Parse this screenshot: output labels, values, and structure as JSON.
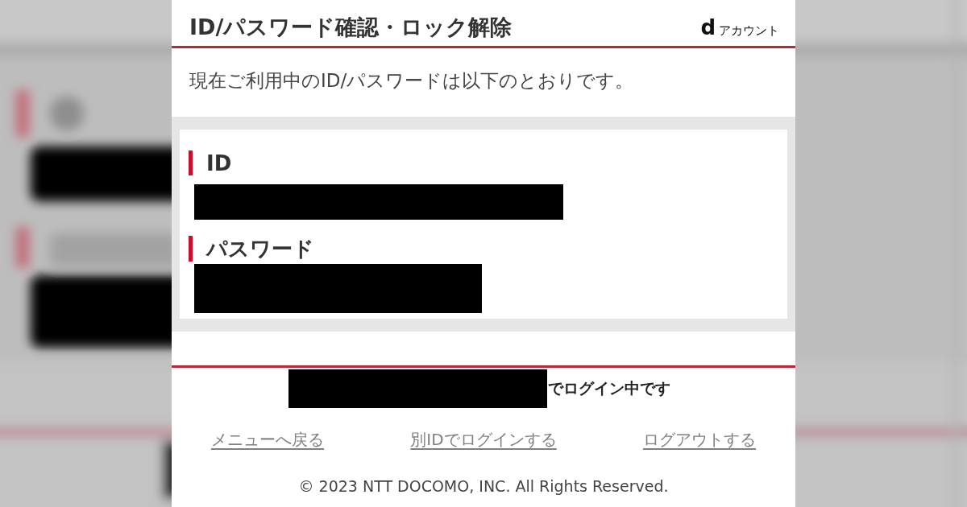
{
  "header": {
    "title": "ID/パスワード確認・ロック解除",
    "brand": {
      "mark": "d",
      "name": "アカウント"
    }
  },
  "intro": "現在ご利用中のID/パスワードは以下のとおりです。",
  "credentials": [
    {
      "label": "ID",
      "redacted": true
    },
    {
      "label": "パスワード",
      "redacted": true
    }
  ],
  "login_status": {
    "redacted": true,
    "text": "でログイン中です"
  },
  "links": [
    "メニューへ戻る",
    "別IDでログインする",
    "ログアウトする"
  ],
  "copyright": "© 2023 NTT DOCOMO, INC. All Rights Reserved."
}
